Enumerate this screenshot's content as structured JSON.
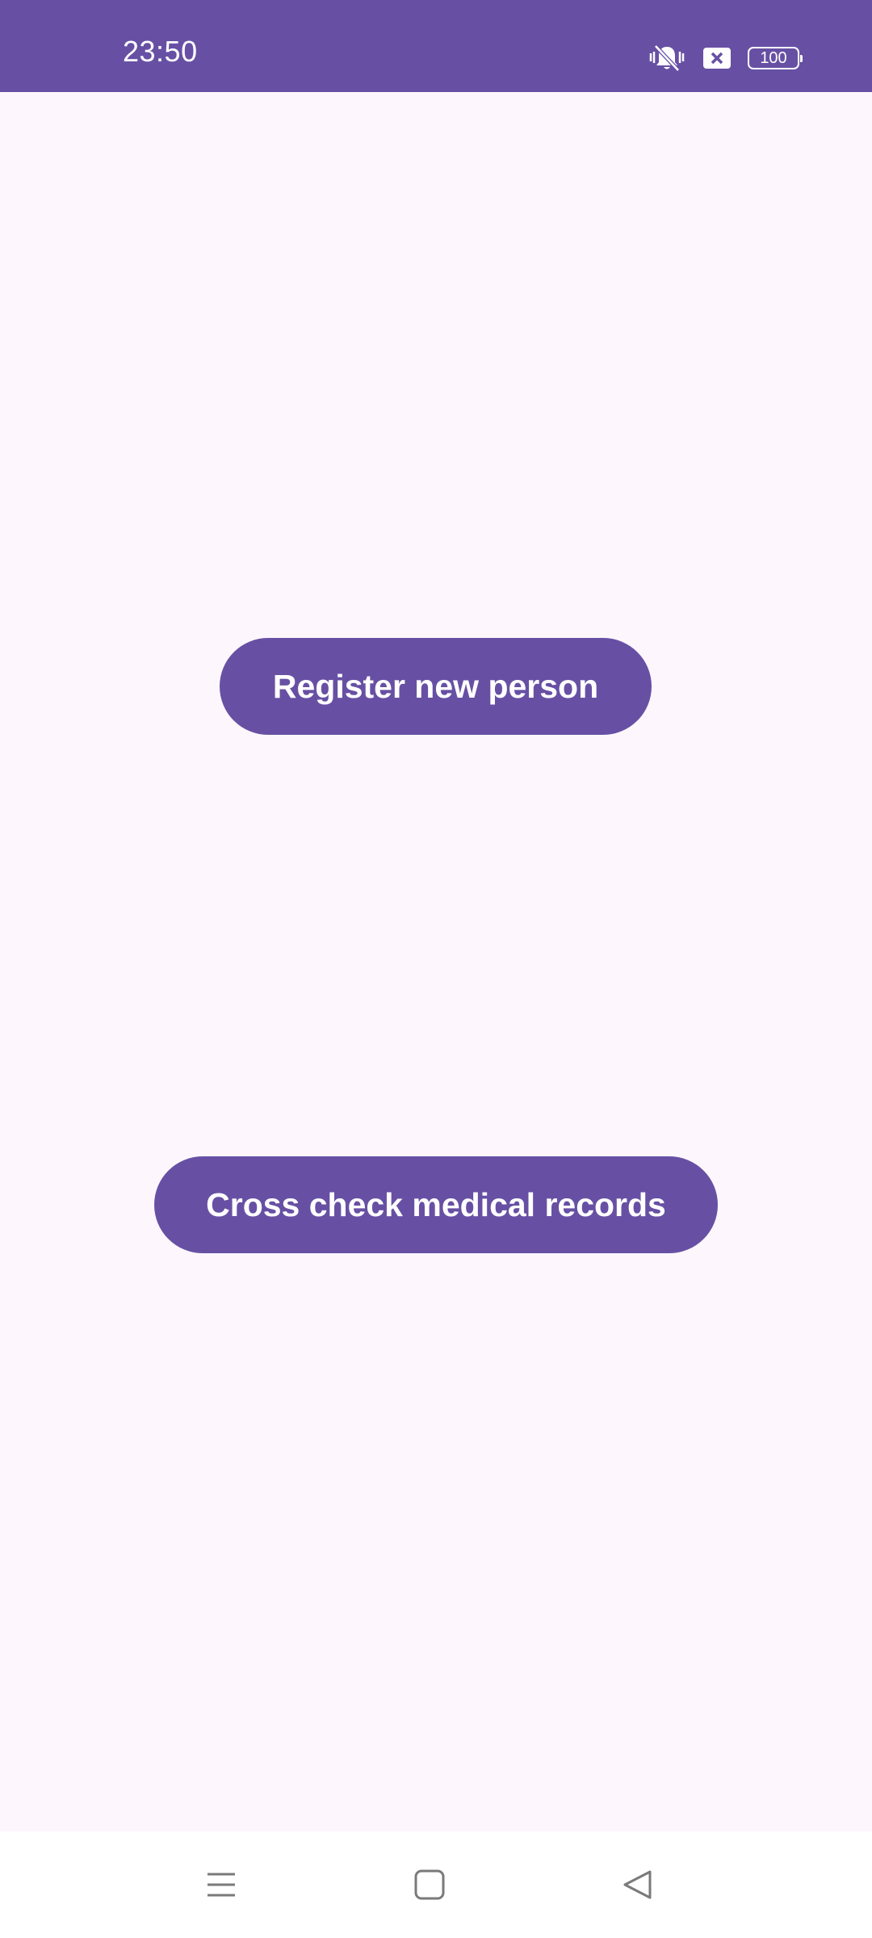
{
  "status_bar": {
    "time": "23:50",
    "battery_level": "100",
    "icons": [
      "vibrate-mute-icon",
      "notification-x-icon",
      "battery-icon"
    ],
    "background_color": "#6750a4"
  },
  "main": {
    "background_color": "#fdf7fd",
    "buttons": [
      {
        "label": "Register new person"
      },
      {
        "label": "Cross check medical records"
      }
    ],
    "button_color": "#6750a4"
  },
  "navigation_bar": {
    "icons": [
      "menu-icon",
      "home-icon",
      "back-icon"
    ]
  }
}
